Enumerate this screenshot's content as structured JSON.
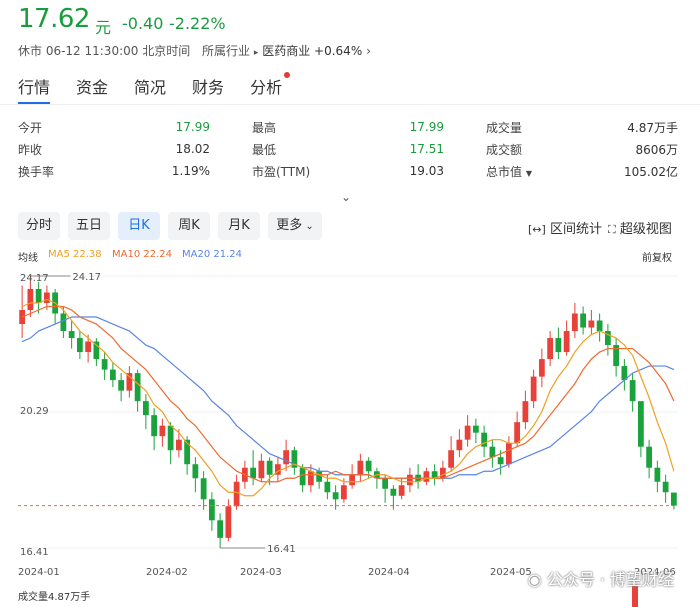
{
  "quote": {
    "price": "17.62",
    "unit": "元",
    "change": "-0.40",
    "change_pct": "-2.22%",
    "status": "休市 06-12 11:30:00 北京时间",
    "industry_label": "所属行业",
    "industry_name": "医药商业",
    "industry_change": "+0.64%"
  },
  "tabs": [
    {
      "label": "行情",
      "active": true
    },
    {
      "label": "资金",
      "active": false
    },
    {
      "label": "简况",
      "active": false
    },
    {
      "label": "财务",
      "active": false
    },
    {
      "label": "分析",
      "active": false,
      "badge_dot": true
    }
  ],
  "stats": [
    [
      {
        "label": "今开",
        "value": "17.99",
        "color": "down"
      },
      {
        "label": "最高",
        "value": "17.99",
        "color": "down"
      },
      {
        "label": "成交量",
        "value": "4.87万手",
        "color": "none"
      }
    ],
    [
      {
        "label": "昨收",
        "value": "18.02",
        "color": "none"
      },
      {
        "label": "最低",
        "value": "17.51",
        "color": "down"
      },
      {
        "label": "成交额",
        "value": "8606万",
        "color": "none"
      }
    ],
    [
      {
        "label": "换手率",
        "value": "1.19%",
        "color": "none"
      },
      {
        "label": "市盈(TTM)",
        "value": "19.03",
        "color": "none"
      },
      {
        "label": "总市值",
        "value": "105.02亿",
        "color": "none",
        "has_caret": true
      }
    ]
  ],
  "periods": [
    {
      "label": "分时",
      "active": false
    },
    {
      "label": "五日",
      "active": false
    },
    {
      "label": "日K",
      "active": true
    },
    {
      "label": "周K",
      "active": false
    },
    {
      "label": "月K",
      "active": false
    },
    {
      "label": "更多",
      "active": false,
      "dropdown": true
    }
  ],
  "tools": {
    "interval_stats": "区间统计",
    "super_view": "超级视图",
    "adjust": "前复权"
  },
  "ma": {
    "title": "均线",
    "ma5": "MA5 22.38",
    "ma10": "MA10 22.24",
    "ma20": "MA20 21.24"
  },
  "colors": {
    "up": "#e8413a",
    "down": "#1aa33d",
    "ma5": "#f0a020",
    "ma10": "#f06a30",
    "ma20": "#5b86e5",
    "accent": "#1d6fe8"
  },
  "chart_data": {
    "type": "candlestick",
    "ylim": [
      16.41,
      24.17
    ],
    "y_ticks": [
      "24.17",
      "20.29",
      "16.41"
    ],
    "x_ticks": [
      "2024-01",
      "2024-02",
      "2024-03",
      "2024-04",
      "2024-05",
      "2024-06"
    ],
    "max_label": "24.17",
    "min_label": "16.41",
    "last_close": 17.62,
    "candles": [
      [
        22.8,
        23.2,
        23.9,
        22.4
      ],
      [
        23.2,
        23.8,
        24.17,
        23.0
      ],
      [
        23.8,
        23.4,
        24.0,
        23.1
      ],
      [
        23.4,
        23.7,
        23.9,
        23.2
      ],
      [
        23.7,
        23.1,
        23.8,
        22.8
      ],
      [
        23.1,
        22.6,
        23.3,
        22.4
      ],
      [
        22.6,
        22.4,
        22.9,
        22.1
      ],
      [
        22.4,
        22.0,
        22.6,
        21.8
      ],
      [
        22.0,
        22.3,
        22.5,
        21.7
      ],
      [
        22.3,
        21.8,
        22.4,
        21.6
      ],
      [
        21.8,
        21.5,
        22.0,
        21.2
      ],
      [
        21.5,
        21.2,
        21.7,
        21.0
      ],
      [
        21.2,
        20.9,
        21.4,
        20.6
      ],
      [
        20.9,
        21.4,
        21.6,
        20.7
      ],
      [
        21.4,
        20.6,
        21.5,
        20.3
      ],
      [
        20.6,
        20.2,
        20.8,
        19.8
      ],
      [
        20.2,
        19.6,
        20.4,
        19.2
      ],
      [
        19.6,
        19.9,
        20.1,
        19.3
      ],
      [
        19.9,
        19.2,
        20.0,
        18.8
      ],
      [
        19.2,
        19.5,
        19.8,
        19.0
      ],
      [
        19.5,
        18.8,
        19.6,
        18.5
      ],
      [
        18.8,
        18.4,
        19.0,
        18.0
      ],
      [
        18.4,
        17.8,
        18.6,
        17.5
      ],
      [
        17.8,
        17.2,
        18.0,
        16.9
      ],
      [
        17.2,
        16.7,
        17.4,
        16.41
      ],
      [
        16.7,
        17.6,
        17.8,
        16.6
      ],
      [
        17.6,
        18.3,
        18.5,
        17.5
      ],
      [
        18.3,
        18.7,
        18.9,
        18.1
      ],
      [
        18.7,
        18.4,
        19.2,
        18.2
      ],
      [
        18.4,
        18.9,
        19.1,
        18.3
      ],
      [
        18.9,
        18.5,
        19.0,
        18.2
      ],
      [
        18.5,
        18.8,
        19.0,
        18.3
      ],
      [
        18.8,
        19.2,
        19.5,
        18.6
      ],
      [
        19.2,
        18.7,
        19.3,
        18.5
      ],
      [
        18.7,
        18.2,
        18.8,
        18.0
      ],
      [
        18.2,
        18.6,
        18.8,
        18.0
      ],
      [
        18.6,
        18.3,
        18.7,
        18.1
      ],
      [
        18.3,
        18.0,
        18.5,
        17.8
      ],
      [
        18.0,
        17.8,
        18.2,
        17.5
      ],
      [
        17.8,
        18.2,
        18.4,
        17.7
      ],
      [
        18.2,
        18.5,
        18.8,
        18.1
      ],
      [
        18.5,
        18.9,
        19.1,
        18.3
      ],
      [
        18.9,
        18.6,
        19.0,
        18.4
      ],
      [
        18.6,
        18.4,
        18.7,
        18.1
      ],
      [
        18.4,
        18.1,
        18.5,
        17.7
      ],
      [
        18.1,
        17.9,
        18.2,
        17.5
      ],
      [
        17.9,
        18.2,
        18.4,
        17.8
      ],
      [
        18.2,
        18.5,
        18.7,
        18.0
      ],
      [
        18.5,
        18.3,
        18.8,
        18.1
      ],
      [
        18.3,
        18.6,
        18.7,
        18.2
      ],
      [
        18.6,
        18.4,
        18.8,
        18.2
      ],
      [
        18.4,
        18.7,
        18.9,
        18.3
      ],
      [
        18.7,
        19.2,
        19.6,
        18.6
      ],
      [
        19.2,
        19.5,
        19.8,
        19.0
      ],
      [
        19.5,
        19.9,
        20.2,
        19.3
      ],
      [
        19.9,
        19.7,
        20.1,
        19.4
      ],
      [
        19.7,
        19.3,
        19.9,
        19.0
      ],
      [
        19.3,
        19.0,
        19.5,
        18.7
      ],
      [
        19.0,
        18.8,
        19.2,
        18.5
      ],
      [
        18.8,
        19.4,
        19.6,
        18.7
      ],
      [
        19.4,
        20.0,
        20.3,
        19.3
      ],
      [
        20.0,
        20.6,
        20.9,
        19.8
      ],
      [
        20.6,
        21.3,
        21.5,
        20.4
      ],
      [
        21.3,
        21.8,
        22.1,
        21.0
      ],
      [
        21.8,
        22.4,
        22.6,
        21.6
      ],
      [
        22.4,
        22.0,
        22.7,
        21.8
      ],
      [
        22.0,
        22.6,
        22.9,
        21.9
      ],
      [
        22.6,
        23.1,
        23.4,
        22.4
      ],
      [
        23.1,
        22.7,
        23.3,
        22.5
      ],
      [
        22.7,
        22.9,
        23.2,
        22.5
      ],
      [
        22.9,
        22.6,
        23.1,
        22.3
      ],
      [
        22.6,
        22.2,
        22.8,
        21.9
      ],
      [
        22.2,
        21.6,
        22.4,
        21.3
      ],
      [
        21.6,
        21.2,
        21.8,
        20.9
      ],
      [
        21.2,
        20.6,
        21.4,
        20.3
      ],
      [
        20.6,
        19.3,
        20.4,
        19.0
      ],
      [
        19.3,
        18.7,
        19.5,
        18.4
      ],
      [
        18.7,
        18.3,
        18.9,
        18.0
      ],
      [
        18.3,
        18.0,
        18.5,
        17.7
      ],
      [
        17.99,
        17.62,
        17.99,
        17.51
      ]
    ],
    "ma5": [
      23.3,
      23.4,
      23.4,
      23.5,
      23.4,
      23.2,
      22.9,
      22.6,
      22.4,
      22.2,
      22.0,
      21.7,
      21.5,
      21.3,
      21.1,
      20.9,
      20.5,
      20.3,
      19.9,
      19.7,
      19.4,
      19.2,
      18.9,
      18.6,
      18.2,
      18.0,
      18.0,
      17.9,
      17.9,
      18.1,
      18.4,
      18.6,
      18.7,
      18.8,
      18.7,
      18.6,
      18.5,
      18.4,
      18.4,
      18.3,
      18.3,
      18.3,
      18.4,
      18.5,
      18.5,
      18.4,
      18.3,
      18.3,
      18.3,
      18.4,
      18.4,
      18.5,
      18.6,
      18.8,
      19.1,
      19.3,
      19.4,
      19.5,
      19.5,
      19.4,
      19.4,
      19.6,
      19.9,
      20.3,
      20.9,
      21.3,
      21.6,
      22.0,
      22.3,
      22.5,
      22.6,
      22.5,
      22.4,
      22.2,
      21.9,
      21.3,
      20.7,
      20.0,
      19.4,
      18.6
    ],
    "ma10": [
      23.0,
      23.1,
      23.2,
      23.3,
      23.3,
      23.3,
      23.2,
      23.0,
      22.9,
      22.8,
      22.6,
      22.4,
      22.1,
      21.9,
      21.7,
      21.5,
      21.2,
      20.9,
      20.6,
      20.4,
      20.1,
      19.9,
      19.6,
      19.3,
      19.0,
      18.8,
      18.6,
      18.5,
      18.4,
      18.3,
      18.3,
      18.3,
      18.4,
      18.4,
      18.5,
      18.5,
      18.5,
      18.5,
      18.6,
      18.5,
      18.5,
      18.5,
      18.5,
      18.4,
      18.4,
      18.4,
      18.4,
      18.4,
      18.4,
      18.4,
      18.4,
      18.4,
      18.5,
      18.6,
      18.7,
      18.8,
      18.9,
      19.0,
      19.1,
      19.2,
      19.3,
      19.4,
      19.6,
      19.9,
      20.2,
      20.5,
      20.8,
      21.1,
      21.5,
      21.8,
      22.0,
      22.1,
      22.1,
      22.1,
      22.1,
      21.9,
      21.7,
      21.4,
      21.1,
      20.6
    ],
    "ma20": [
      22.3,
      22.4,
      22.6,
      22.7,
      22.8,
      22.9,
      23.0,
      23.0,
      23.0,
      23.0,
      22.9,
      22.8,
      22.7,
      22.6,
      22.4,
      22.2,
      22.1,
      21.9,
      21.7,
      21.5,
      21.3,
      21.1,
      20.9,
      20.6,
      20.4,
      20.2,
      19.9,
      19.7,
      19.5,
      19.3,
      19.1,
      19.0,
      18.9,
      18.8,
      18.7,
      18.7,
      18.6,
      18.6,
      18.5,
      18.5,
      18.5,
      18.5,
      18.5,
      18.4,
      18.4,
      18.4,
      18.4,
      18.4,
      18.4,
      18.4,
      18.4,
      18.4,
      18.4,
      18.5,
      18.5,
      18.5,
      18.6,
      18.6,
      18.7,
      18.8,
      18.9,
      19.0,
      19.1,
      19.2,
      19.3,
      19.5,
      19.7,
      19.9,
      20.1,
      20.3,
      20.6,
      20.8,
      21.0,
      21.2,
      21.4,
      21.5,
      21.6,
      21.6,
      21.6,
      21.5
    ]
  },
  "volume_label": "成交量4.87万手",
  "watermark": "公众号 · 博望财经"
}
